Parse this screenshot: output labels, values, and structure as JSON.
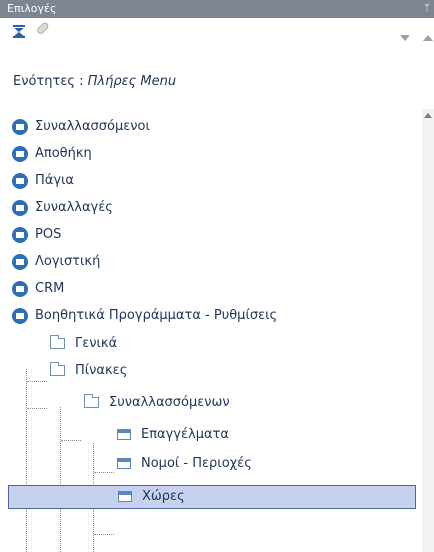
{
  "panel": {
    "title": "Επιλογές"
  },
  "toolbar": {
    "icons": [
      "collapse-all-icon",
      "clear-icon",
      "dropdown-arrow-icon",
      "scroll-up-arrow-icon"
    ]
  },
  "sections": {
    "label": "Ενότητες :",
    "value": "Πλήρες Menu"
  },
  "tree": {
    "top_items": [
      "Συναλλασσόμενοι",
      "Αποθήκη",
      "Πάγια",
      "Συναλλαγές",
      "POS",
      "Λογιστική",
      "CRM",
      "Βοηθητικά Προγράμματα - Ρυθμίσεις"
    ],
    "sub_items": [
      "Γενικά",
      "Πίνακες"
    ],
    "sub_sub_items": [
      "Συναλλασσόμενων"
    ],
    "leaf_items": [
      "Επαγγέλματα",
      "Νομοί - Περιοχές",
      "Χώρες"
    ],
    "selected": "Χώρες"
  },
  "colors": {
    "titlebar": "#7d8593",
    "bullet": "#2d6eb4",
    "text": "#1f3455",
    "selection": "#c5d1ef"
  }
}
